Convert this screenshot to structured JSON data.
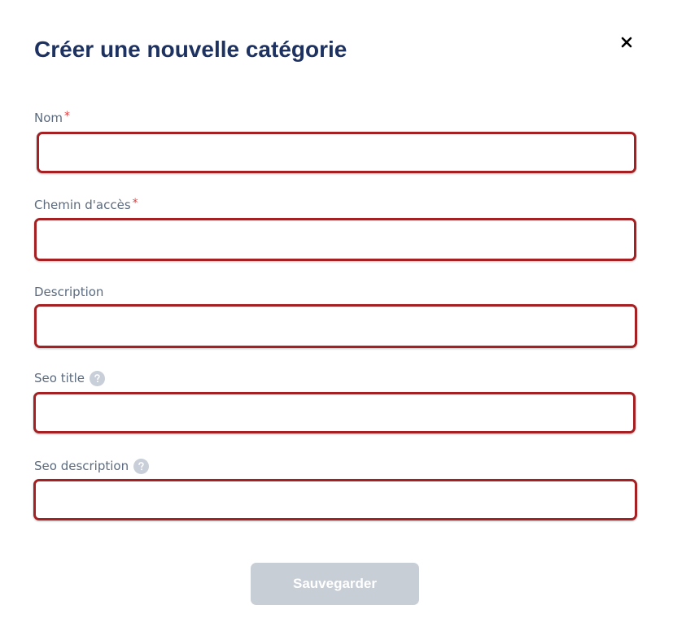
{
  "modal": {
    "title": "Créer une nouvelle catégorie",
    "close_icon": "close-icon"
  },
  "form": {
    "fields": [
      {
        "label": "Nom",
        "required": true,
        "required_mark": "*",
        "help": false,
        "value": "",
        "state": "error"
      },
      {
        "label": "Chemin d'accès",
        "required": true,
        "required_mark": "*",
        "help": false,
        "value": "",
        "state": "error"
      },
      {
        "label": "Description",
        "required": false,
        "help": false,
        "value": "",
        "state": "error"
      },
      {
        "label": "Seo title",
        "required": false,
        "help": true,
        "help_icon": "question-icon",
        "value": "",
        "state": "error"
      },
      {
        "label": "Seo description",
        "required": false,
        "help": true,
        "help_icon": "question-icon",
        "value": "",
        "state": "error"
      }
    ],
    "submit": {
      "label": "Sauvegarder",
      "disabled": true
    }
  },
  "colors": {
    "title": "#1d3261",
    "label": "#5c6b7f",
    "required": "#d64545",
    "error_border": "#a52022",
    "button_disabled_bg": "#c8ced6",
    "help_icon_bg": "#c9cfd8"
  }
}
